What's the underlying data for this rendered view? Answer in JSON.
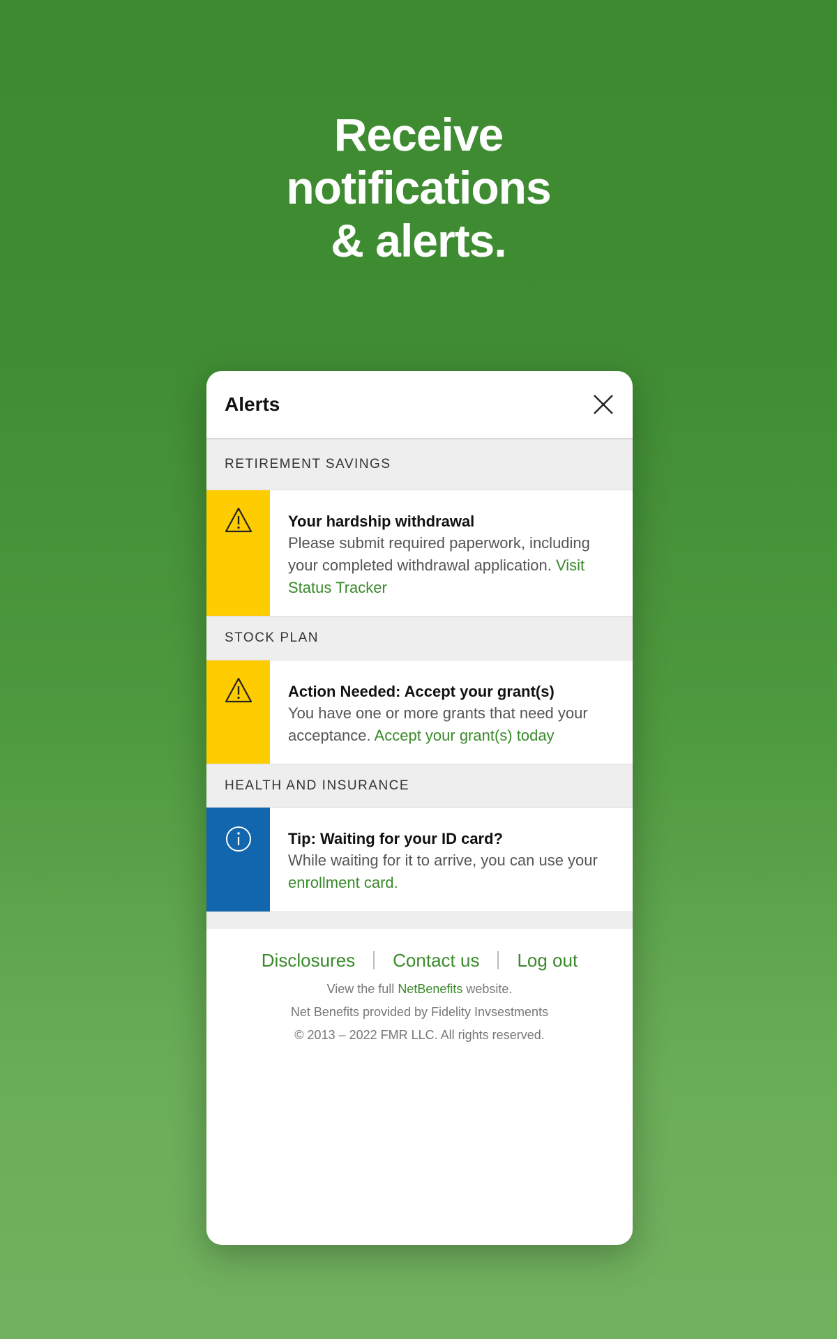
{
  "headline": {
    "line1": "Receive",
    "line2": "notifications",
    "line3": "& alerts."
  },
  "panel": {
    "title": "Alerts",
    "close_icon": "close-icon"
  },
  "sections": [
    {
      "label": "RETIREMENT SAVINGS",
      "alert": {
        "type": "warning",
        "icon": "warning-triangle-icon",
        "title": "Your hardship withdrawal",
        "text": "Please submit required paperwork, including your completed withdrawal application. ",
        "link": "Visit Status Tracker"
      }
    },
    {
      "label": "STOCK PLAN",
      "alert": {
        "type": "warning",
        "icon": "warning-triangle-icon",
        "title": "Action Needed: Accept your grant(s)",
        "text": "You have one or more grants that need your acceptance. ",
        "link": "Accept your grant(s) today"
      }
    },
    {
      "label": "HEALTH AND INSURANCE",
      "alert": {
        "type": "info",
        "icon": "info-circle-icon",
        "title": "Tip: Waiting for your ID card?",
        "text": "While waiting for it to arrive, you can use your ",
        "link": "enrollment card."
      }
    }
  ],
  "footer": {
    "links": [
      "Disclosures",
      "Contact us",
      "Log out"
    ],
    "view_prefix": "View the full ",
    "view_link": "NetBenefits",
    "view_suffix": " website.",
    "provided_by": "Net Benefits provided by Fidelity Invsestments",
    "copyright": "© 2013 – 2022 FMR LLC. All rights reserved."
  },
  "colors": {
    "brand_green": "#3a8a2b",
    "warning": "#ffcc00",
    "info": "#1266ae"
  }
}
